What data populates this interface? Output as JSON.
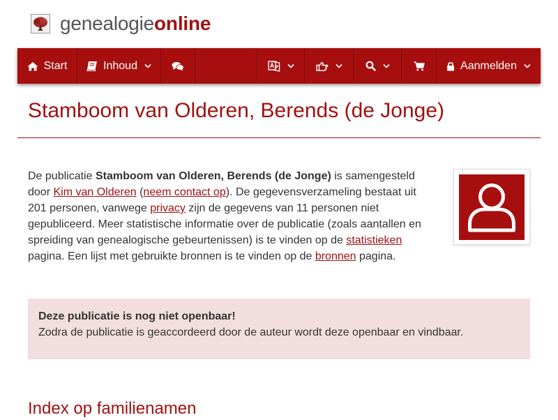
{
  "brand": {
    "name_part1": "genealogie",
    "name_part2": "online"
  },
  "nav": {
    "start_label": "Start",
    "content_label": "Inhoud",
    "login_label": "Aanmelden",
    "icons": [
      "home-icon",
      "book-icon",
      "chat-icon",
      "translate-icon",
      "hand-point-icon",
      "search-icon",
      "cart-icon",
      "lock-icon"
    ]
  },
  "page": {
    "title": "Stamboom van Olderen, Berends (de Jonge)"
  },
  "intro": {
    "t1": "De publicatie ",
    "pub_name": "Stamboom van Olderen, Berends (de Jonge)",
    "t2": " is samengesteld door ",
    "author_link": "Kim van Olderen",
    "t3": " (",
    "contact_link": "neem contact op",
    "t4": "). De gegevensverzameling bestaat uit 201 personen, vanwege ",
    "privacy_link": "privacy",
    "t5": " zijn de gegevens van 11 personen niet gepubliceerd. Meer statistische informatie over de publicatie (zoals aantallen en spreiding van genealogische gebeurtenissen) is te vinden op de ",
    "stats_link": "statistieken",
    "t6": " pagina. Een lijst met gebruikte bronnen is te vinden op de ",
    "sources_link": "bronnen",
    "t7": " pagina."
  },
  "alert": {
    "title": "Deze publicatie is nog niet openbaar!",
    "text": "Zodra de publicatie is geaccordeerd door de auteur wordt deze openbaar en vindbaar."
  },
  "index": {
    "heading": "Index op familienamen"
  },
  "colors": {
    "brand_red": "#a70f0f",
    "link_red": "#a11111",
    "alert_bg": "#f2dede",
    "text": "#333333"
  }
}
